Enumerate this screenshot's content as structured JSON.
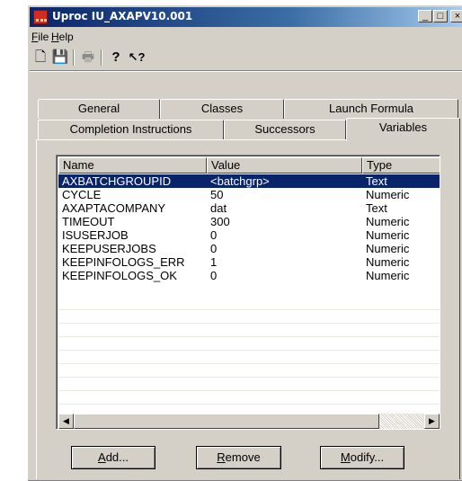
{
  "window": {
    "title": "Uproc IU_AXAPV10.001",
    "controls": [
      "minimize",
      "maximize",
      "close"
    ]
  },
  "menu": [
    {
      "label": "File",
      "accel": "F",
      "rest": "ile"
    },
    {
      "label": "Help",
      "accel": "H",
      "rest": "elp"
    }
  ],
  "toolbar": [
    {
      "name": "new-document-icon",
      "glyph": "🗋",
      "enabled": true
    },
    {
      "name": "save-icon",
      "glyph": "💾",
      "enabled": true
    },
    {
      "name": "print-icon",
      "glyph": "🖶",
      "enabled": false
    },
    {
      "name": "help-icon",
      "glyph": "?",
      "enabled": true
    },
    {
      "name": "context-help-icon",
      "glyph": "↖?",
      "enabled": true
    }
  ],
  "tabs_back": [
    "General",
    "Classes",
    "Launch Formula"
  ],
  "tabs_front": [
    "Completion Instructions",
    "Successors",
    "Variables"
  ],
  "active_tab": "Variables",
  "list": {
    "columns": [
      "Name",
      "Value",
      "Type"
    ],
    "rows": [
      {
        "name": "AXBATCHGROUPID",
        "value": "<batchgrp>",
        "type": "Text",
        "selected": true
      },
      {
        "name": "CYCLE",
        "value": "50",
        "type": "Numeric"
      },
      {
        "name": "AXAPTACOMPANY",
        "value": "dat",
        "type": "Text"
      },
      {
        "name": "TIMEOUT",
        "value": "300",
        "type": "Numeric"
      },
      {
        "name": "ISUSERJOB",
        "value": "0",
        "type": "Numeric"
      },
      {
        "name": "KEEPUSERJOBS",
        "value": "0",
        "type": "Numeric"
      },
      {
        "name": "KEEPINFOLOGS_ERR",
        "value": "1",
        "type": "Numeric"
      },
      {
        "name": "KEEPINFOLOGS_OK",
        "value": "0",
        "type": "Numeric"
      }
    ]
  },
  "buttons": {
    "add": {
      "accel": "A",
      "rest": "dd..."
    },
    "remove": {
      "accel": "R",
      "rest": "emove"
    },
    "modify": {
      "accel": "M",
      "rest": "odify..."
    }
  },
  "colors": {
    "selection": "#0a246a",
    "titlebar_start": "#0a246a",
    "face": "#d4d0c8"
  }
}
